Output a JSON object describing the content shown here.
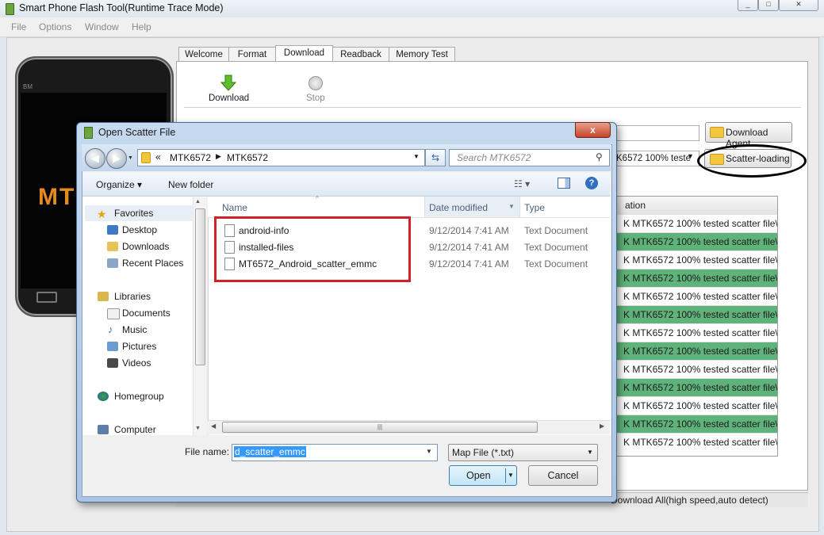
{
  "window": {
    "title": "Smart Phone Flash Tool(Runtime Trace Mode)",
    "menu": [
      "File",
      "Options",
      "Window",
      "Help"
    ]
  },
  "phone": {
    "logo": "MT",
    "brand": "BM"
  },
  "tabs": [
    "Welcome",
    "Format",
    "Download",
    "Readback",
    "Memory Test"
  ],
  "active_tab": "Download",
  "toolbar": {
    "download_label": "Download",
    "stop_label": "Stop"
  },
  "controls": {
    "download_agent_button": "Download Agent",
    "scatter_value": "K6572 100% teste",
    "scatter_loading_button": "Scatter-loading"
  },
  "grid": {
    "header": "ation",
    "rows": [
      {
        "text": "K MTK6572 100% tested scatter file\\...",
        "highlight": false
      },
      {
        "text": "K MTK6572 100% tested scatter file\\...",
        "highlight": true
      },
      {
        "text": "K MTK6572 100% tested scatter file\\...",
        "highlight": false
      },
      {
        "text": "K MTK6572 100% tested scatter file\\...",
        "highlight": true
      },
      {
        "text": "K MTK6572 100% tested scatter file\\...",
        "highlight": false
      },
      {
        "text": "K MTK6572 100% tested scatter file\\...",
        "highlight": true
      },
      {
        "text": "K MTK6572 100% tested scatter file\\...",
        "highlight": false
      },
      {
        "text": "K MTK6572 100% tested scatter file\\...",
        "highlight": true
      },
      {
        "text": "K MTK6572 100% tested scatter file\\...",
        "highlight": false
      },
      {
        "text": "K MTK6572 100% tested scatter file\\...",
        "highlight": true
      },
      {
        "text": "K MTK6572 100% tested scatter file\\...",
        "highlight": false
      },
      {
        "text": "K MTK6572 100% tested scatter file\\...",
        "highlight": true
      },
      {
        "text": "K MTK6572 100% tested scatter file\\...",
        "highlight": false
      }
    ]
  },
  "status": {
    "text": "Download All(high speed,auto detect)"
  },
  "dialog": {
    "title": "Open Scatter File",
    "close": "x",
    "breadcrumb": [
      "MTK6572",
      "MTK6572"
    ],
    "breadcrumb_prefix": "«",
    "search_placeholder": "Search MTK6572",
    "organize": "Organize ▾",
    "new_folder": "New folder",
    "nav": {
      "favorites": "Favorites",
      "favorites_items": [
        "Desktop",
        "Downloads",
        "Recent Places"
      ],
      "libraries": "Libraries",
      "libraries_items": [
        "Documents",
        "Music",
        "Pictures",
        "Videos"
      ],
      "homegroup": "Homegroup",
      "computer": "Computer"
    },
    "columns": {
      "name": "Name",
      "date": "Date modified",
      "type": "Type"
    },
    "files": [
      {
        "name": "android-info",
        "date": "9/12/2014 7:41 AM",
        "type": "Text Document"
      },
      {
        "name": "installed-files",
        "date": "9/12/2014 7:41 AM",
        "type": "Text Document"
      },
      {
        "name": "MT6572_Android_scatter_emmc",
        "date": "9/12/2014 7:41 AM",
        "type": "Text Document"
      }
    ],
    "file_name_label": "File name:",
    "file_name_value": "d_scatter_emmc",
    "file_type": "Map File (*.txt)",
    "open_button": "Open",
    "cancel_button": "Cancel"
  }
}
